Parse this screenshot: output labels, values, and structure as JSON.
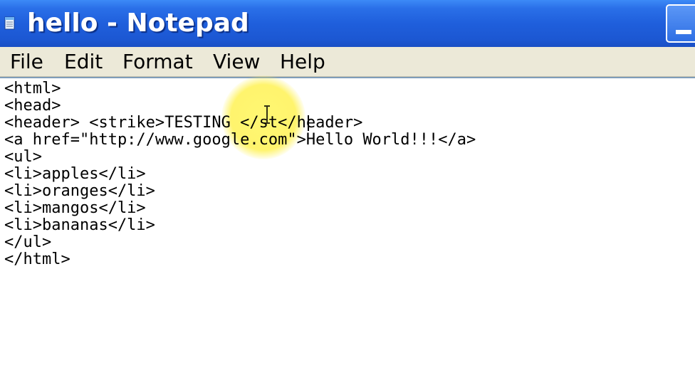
{
  "window": {
    "title": "hello - Notepad",
    "title_color": "#ffffff",
    "titlebar_color": "#1f5fdc"
  },
  "menu": {
    "items": [
      "File",
      "Edit",
      "Format",
      "View",
      "Help"
    ]
  },
  "editor": {
    "lines": [
      "<html>",
      "<head>",
      "<header> <strike>TESTING </st</header>",
      "<a href=\"http://www.google.com\">Hello World!!!</a>",
      "<ul>",
      "<li>apples</li>",
      "<li>oranges</li>",
      "<li>mangos</li>",
      "<li>bananas</li>",
      "</ul>",
      "</html>"
    ],
    "text_color": "#000000",
    "cursor_highlight_color": "#fff35a"
  },
  "icons": {
    "app": "notepad-icon",
    "minimize": "minimize-icon",
    "pointer": "ibeam-cursor-icon"
  }
}
